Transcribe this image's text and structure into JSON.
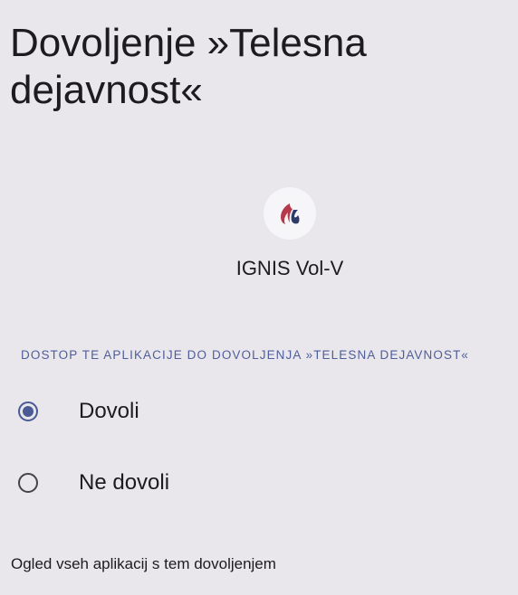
{
  "page": {
    "title": "Dovoljenje »Telesna dejavnost«"
  },
  "app": {
    "name": "IGNIS Vol-V",
    "icon": "flame-logo-icon",
    "icon_colors": {
      "left_flame": "#b5394a",
      "right_flame": "#2e3b66",
      "circle_bg": "#f6f5f8"
    }
  },
  "section": {
    "header": "DOSTOP TE APLIKACIJE DO DOVOLJENJA »TELESNA DEJAVNOST«"
  },
  "options": [
    {
      "label": "Dovoli",
      "selected": true
    },
    {
      "label": "Ne dovoli",
      "selected": false
    }
  ],
  "footer": {
    "link": "Ogled vseh aplikacij s tem dovoljenjem"
  },
  "colors": {
    "background": "#e9e7ec",
    "accent": "#4a5a95",
    "text": "#1d1b20"
  }
}
